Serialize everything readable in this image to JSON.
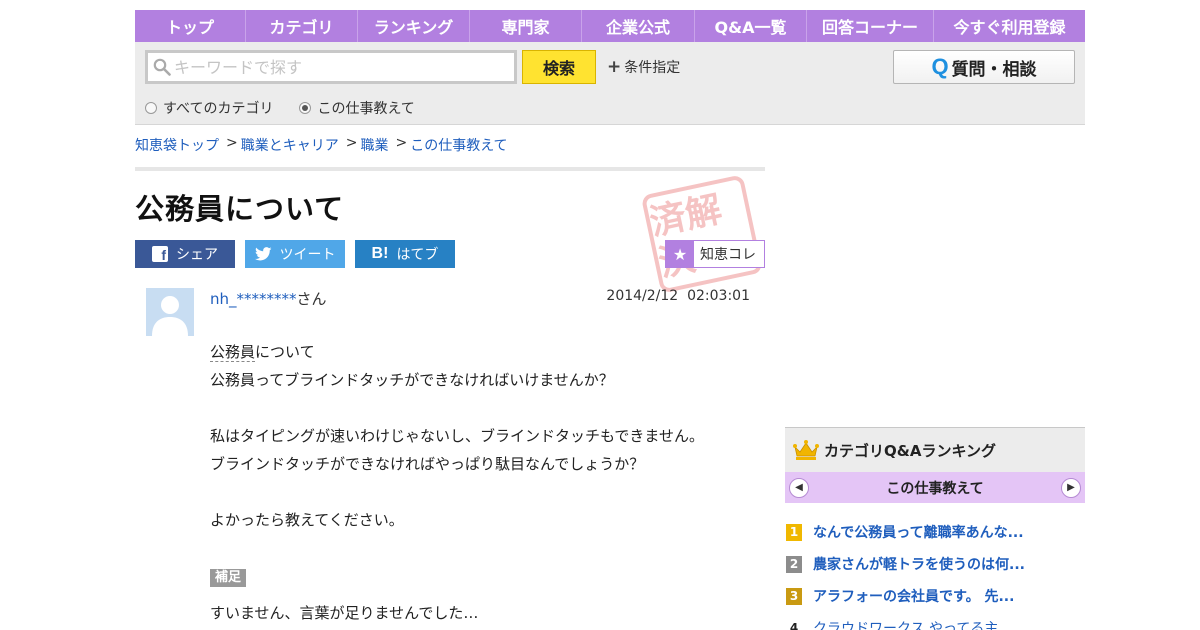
{
  "nav": [
    {
      "label": "トップ"
    },
    {
      "label": "カテゴリ"
    },
    {
      "label": "ランキング"
    },
    {
      "label": "専門家"
    },
    {
      "label": "企業公式"
    },
    {
      "label": "Q&A一覧"
    },
    {
      "label": "回答コーナー"
    },
    {
      "label": "今すぐ利用登録"
    }
  ],
  "search": {
    "placeholder": "キーワードで探す",
    "button": "検索",
    "conditions": "条件指定",
    "scope_all": "すべてのカテゴリ",
    "scope_current": "この仕事教えて",
    "selected_scope": "current"
  },
  "ask_button": {
    "icon_letter": "Q",
    "label": "質問・相談"
  },
  "breadcrumb": [
    "知恵袋トップ",
    "職業とキャリア",
    "職業",
    "この仕事教えて"
  ],
  "question": {
    "title": "公務員について",
    "stamp": "済解決",
    "share": {
      "facebook": "シェア",
      "twitter": "ツイート",
      "hatena": "はてブ",
      "hatena_icon": "B!"
    },
    "chiecolle": "知恵コレ",
    "user": "nh_********",
    "honorific": "さん",
    "date": "2014/2/12",
    "time": "02:03:01",
    "keyword": "公務員",
    "first_line_rest": "について",
    "lines": [
      "公務員ってブラインドタッチができなければいけませんか？",
      "",
      "私はタイピングが速いわけじゃないし、ブラインドタッチもできません。",
      "ブラインドタッチができなければやっぱり駄目なんでしょうか？",
      "",
      "よかったら教えてください。"
    ],
    "addendum_label": "補足",
    "addendum": "すいません、言葉が足りませんでした…"
  },
  "ranking": {
    "header": "カテゴリQ&Aランキング",
    "category": "この仕事教えて",
    "items": [
      {
        "rank": "1",
        "title": "なんで公務員って離職率あんな...",
        "color": "#f0b800"
      },
      {
        "rank": "2",
        "title": "農家さんが軽トラを使うのは何...",
        "color": "#8c8c8c"
      },
      {
        "rank": "3",
        "title": "アラフォーの会社員です。 先...",
        "color": "#c99a12"
      },
      {
        "rank": "4",
        "title": "クラウドワークス やってる主...",
        "color": ""
      }
    ]
  },
  "colors": {
    "nav": "#b280e0",
    "link": "#1f5ebd",
    "search_button": "#ffe330",
    "ranking_category": "#e4c5f6"
  }
}
